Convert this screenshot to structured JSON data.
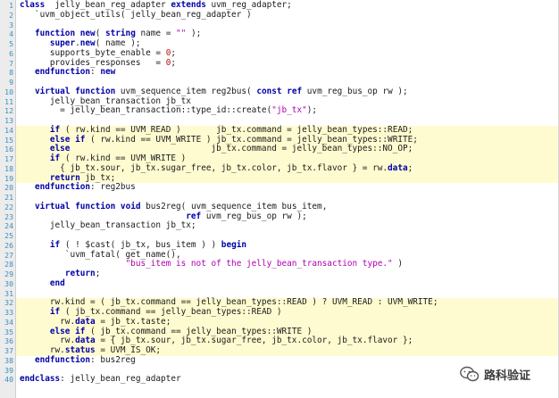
{
  "code_lines": [
    {
      "n": "1",
      "hl": false,
      "t": [
        [
          "kw",
          "class"
        ],
        [
          "",
          "  jelly_bean_reg_adapter "
        ],
        [
          "kw",
          "extends"
        ],
        [
          "",
          " uvm_reg_adapter;"
        ]
      ]
    },
    {
      "n": "2",
      "hl": false,
      "t": [
        [
          "",
          "   `uvm_object_utils( jelly_bean_reg_adapter )"
        ]
      ]
    },
    {
      "n": "3",
      "hl": false,
      "t": []
    },
    {
      "n": "4",
      "hl": false,
      "t": [
        [
          "",
          "   "
        ],
        [
          "kw",
          "function"
        ],
        [
          "",
          " "
        ],
        [
          "kw",
          "new"
        ],
        [
          "",
          "( "
        ],
        [
          "kw",
          "string"
        ],
        [
          "",
          " name = "
        ],
        [
          "str",
          "\"\""
        ],
        [
          "",
          " );"
        ]
      ]
    },
    {
      "n": "5",
      "hl": false,
      "t": [
        [
          "",
          "      "
        ],
        [
          "kw",
          "super"
        ],
        [
          "",
          "."
        ],
        [
          "kw",
          "new"
        ],
        [
          "",
          "( name );"
        ]
      ]
    },
    {
      "n": "6",
      "hl": false,
      "t": [
        [
          "",
          "      supports_byte_enable = "
        ],
        [
          "num",
          "0"
        ],
        [
          "",
          ";"
        ]
      ]
    },
    {
      "n": "7",
      "hl": false,
      "t": [
        [
          "",
          "      provides_responses   = "
        ],
        [
          "num",
          "0"
        ],
        [
          "",
          ";"
        ]
      ]
    },
    {
      "n": "8",
      "hl": false,
      "t": [
        [
          "",
          "   "
        ],
        [
          "kw",
          "endfunction"
        ],
        [
          "",
          ": "
        ],
        [
          "kw",
          "new"
        ]
      ]
    },
    {
      "n": "9",
      "hl": false,
      "t": []
    },
    {
      "n": "10",
      "hl": false,
      "t": [
        [
          "",
          "   "
        ],
        [
          "kw",
          "virtual"
        ],
        [
          "",
          " "
        ],
        [
          "kw",
          "function"
        ],
        [
          "",
          " uvm_sequence_item reg2bus( "
        ],
        [
          "kw",
          "const"
        ],
        [
          "",
          " "
        ],
        [
          "kw",
          "ref"
        ],
        [
          "",
          " uvm_reg_bus_op rw );"
        ]
      ]
    },
    {
      "n": "11",
      "hl": false,
      "t": [
        [
          "",
          "      jelly_bean_transaction jb_tx"
        ]
      ]
    },
    {
      "n": "12",
      "hl": false,
      "t": [
        [
          "",
          "        = jelly_bean_transaction::type_id::create("
        ],
        [
          "str",
          "\"jb_tx\""
        ],
        [
          "",
          ");"
        ]
      ]
    },
    {
      "n": "13",
      "hl": false,
      "t": []
    },
    {
      "n": "14",
      "hl": true,
      "t": [
        [
          "",
          "      "
        ],
        [
          "kw",
          "if"
        ],
        [
          "",
          " ( rw.kind == UVM_READ )       jb_tx.command = jelly_bean_types::READ;"
        ]
      ]
    },
    {
      "n": "15",
      "hl": true,
      "t": [
        [
          "",
          "      "
        ],
        [
          "kw",
          "else"
        ],
        [
          "",
          " "
        ],
        [
          "kw",
          "if"
        ],
        [
          "",
          " ( rw.kind == UVM_WRITE ) jb_tx.command = jelly_bean_types::WRITE;"
        ]
      ]
    },
    {
      "n": "16",
      "hl": true,
      "t": [
        [
          "",
          "      "
        ],
        [
          "kw",
          "else"
        ],
        [
          "",
          "                            jb_tx.command = jelly_bean_types::NO_OP;"
        ]
      ]
    },
    {
      "n": "17",
      "hl": true,
      "t": [
        [
          "",
          "      "
        ],
        [
          "kw",
          "if"
        ],
        [
          "",
          " ( rw.kind == UVM_WRITE )"
        ]
      ]
    },
    {
      "n": "18",
      "hl": true,
      "t": [
        [
          "",
          "        { jb_tx.sour, jb_tx.sugar_free, jb_tx.color, jb_tx.flavor } = rw."
        ],
        [
          "kw",
          "data"
        ],
        [
          "",
          ";"
        ]
      ]
    },
    {
      "n": "19",
      "hl": true,
      "t": [
        [
          "",
          "      "
        ],
        [
          "kw",
          "return"
        ],
        [
          "",
          " jb_tx;"
        ]
      ]
    },
    {
      "n": "20",
      "hl": false,
      "t": [
        [
          "",
          "   "
        ],
        [
          "kw",
          "endfunction"
        ],
        [
          "",
          ": reg2bus"
        ]
      ]
    },
    {
      "n": "21",
      "hl": false,
      "t": []
    },
    {
      "n": "22",
      "hl": false,
      "t": [
        [
          "",
          "   "
        ],
        [
          "kw",
          "virtual"
        ],
        [
          "",
          " "
        ],
        [
          "kw",
          "function"
        ],
        [
          "",
          " "
        ],
        [
          "kw",
          "void"
        ],
        [
          "",
          " bus2reg( uvm_sequence_item bus_item,"
        ]
      ]
    },
    {
      "n": "23",
      "hl": false,
      "t": [
        [
          "",
          "                                 "
        ],
        [
          "kw",
          "ref"
        ],
        [
          "",
          " uvm_reg_bus_op rw );"
        ]
      ]
    },
    {
      "n": "24",
      "hl": false,
      "t": [
        [
          "",
          "      jelly_bean_transaction jb_tx;"
        ]
      ]
    },
    {
      "n": "25",
      "hl": false,
      "t": []
    },
    {
      "n": "26",
      "hl": false,
      "t": [
        [
          "",
          "      "
        ],
        [
          "kw",
          "if"
        ],
        [
          "",
          " ( ! $cast( jb_tx, bus_item ) ) "
        ],
        [
          "kw",
          "begin"
        ]
      ]
    },
    {
      "n": "27",
      "hl": false,
      "t": [
        [
          "",
          "         `uvm_fatal( get_name(),"
        ]
      ]
    },
    {
      "n": "28",
      "hl": false,
      "t": [
        [
          "",
          "                     "
        ],
        [
          "str",
          "\"bus_item is not of the jelly_bean_transaction type.\""
        ],
        [
          "",
          " )"
        ]
      ]
    },
    {
      "n": "29",
      "hl": false,
      "t": [
        [
          "",
          "         "
        ],
        [
          "kw",
          "return"
        ],
        [
          "",
          ";"
        ]
      ]
    },
    {
      "n": "30",
      "hl": false,
      "t": [
        [
          "",
          "      "
        ],
        [
          "kw",
          "end"
        ]
      ]
    },
    {
      "n": "31",
      "hl": false,
      "t": []
    },
    {
      "n": "32",
      "hl": true,
      "t": [
        [
          "",
          "      rw.kind = ( jb_tx.command == jelly_bean_types::READ ) ? UVM_READ : UVM_WRITE;"
        ]
      ]
    },
    {
      "n": "33",
      "hl": true,
      "t": [
        [
          "",
          "      "
        ],
        [
          "kw",
          "if"
        ],
        [
          "",
          " ( jb_tx.command == jelly_bean_types::READ )"
        ]
      ]
    },
    {
      "n": "34",
      "hl": true,
      "t": [
        [
          "",
          "        rw."
        ],
        [
          "kw",
          "data"
        ],
        [
          "",
          " = jb_tx.taste;"
        ]
      ]
    },
    {
      "n": "35",
      "hl": true,
      "t": [
        [
          "",
          "      "
        ],
        [
          "kw",
          "else"
        ],
        [
          "",
          " "
        ],
        [
          "kw",
          "if"
        ],
        [
          "",
          " ( jb_tx.command == jelly_bean_types::WRITE )"
        ]
      ]
    },
    {
      "n": "36",
      "hl": true,
      "t": [
        [
          "",
          "        rw."
        ],
        [
          "kw",
          "data"
        ],
        [
          "",
          " = { jb_tx.sour, jb_tx.sugar_free, jb_tx.color, jb_tx.flavor };"
        ]
      ]
    },
    {
      "n": "37",
      "hl": true,
      "t": [
        [
          "",
          "      rw."
        ],
        [
          "kw",
          "status"
        ],
        [
          "",
          " = UVM_IS_OK;"
        ]
      ]
    },
    {
      "n": "38",
      "hl": false,
      "t": [
        [
          "",
          "   "
        ],
        [
          "kw",
          "endfunction"
        ],
        [
          "",
          ": bus2reg"
        ]
      ]
    },
    {
      "n": "39",
      "hl": false,
      "t": []
    },
    {
      "n": "40",
      "hl": false,
      "t": [
        [
          "kw",
          "endclass"
        ],
        [
          "",
          ": jelly_bean_reg_adapter"
        ]
      ]
    }
  ],
  "watermark": {
    "text": "路科验证",
    "icon": "wechat-icon"
  },
  "colors": {
    "keyword": "#0000a8",
    "string": "#b000b0",
    "number": "#c01010",
    "highlight": "#fffbd0",
    "line_number": "#3a8fbf"
  }
}
